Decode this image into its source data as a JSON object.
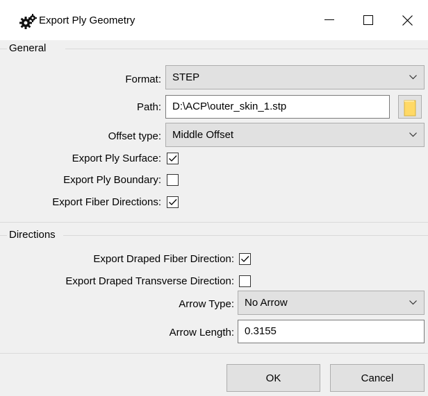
{
  "window": {
    "title": "Export Ply Geometry",
    "icon": "gears-icon"
  },
  "controls": {
    "minimize_icon": "minimize-icon",
    "maximize_icon": "maximize-icon",
    "close_icon": "close-icon"
  },
  "general": {
    "title": "General",
    "format_label": "Format:",
    "format_value": "STEP",
    "path_label": "Path:",
    "path_value": "D:\\ACP\\outer_skin_1.stp",
    "offset_label": "Offset type:",
    "offset_value": "Middle Offset",
    "export_surface_label": "Export Ply Surface:",
    "export_surface_checked": true,
    "export_boundary_label": "Export Ply Boundary:",
    "export_boundary_checked": false,
    "export_fiber_label": "Export Fiber Directions:",
    "export_fiber_checked": true
  },
  "directions": {
    "title": "Directions",
    "draped_fiber_label": "Export Draped Fiber Direction:",
    "draped_fiber_checked": true,
    "draped_transverse_label": "Export Draped Transverse Direction:",
    "draped_transverse_checked": false,
    "arrow_type_label": "Arrow Type:",
    "arrow_type_value": "No Arrow",
    "arrow_length_label": "Arrow Length:",
    "arrow_length_value": "0.3155"
  },
  "buttons": {
    "ok": "OK",
    "cancel": "Cancel"
  },
  "colors": {
    "folder": "#ffd966"
  }
}
